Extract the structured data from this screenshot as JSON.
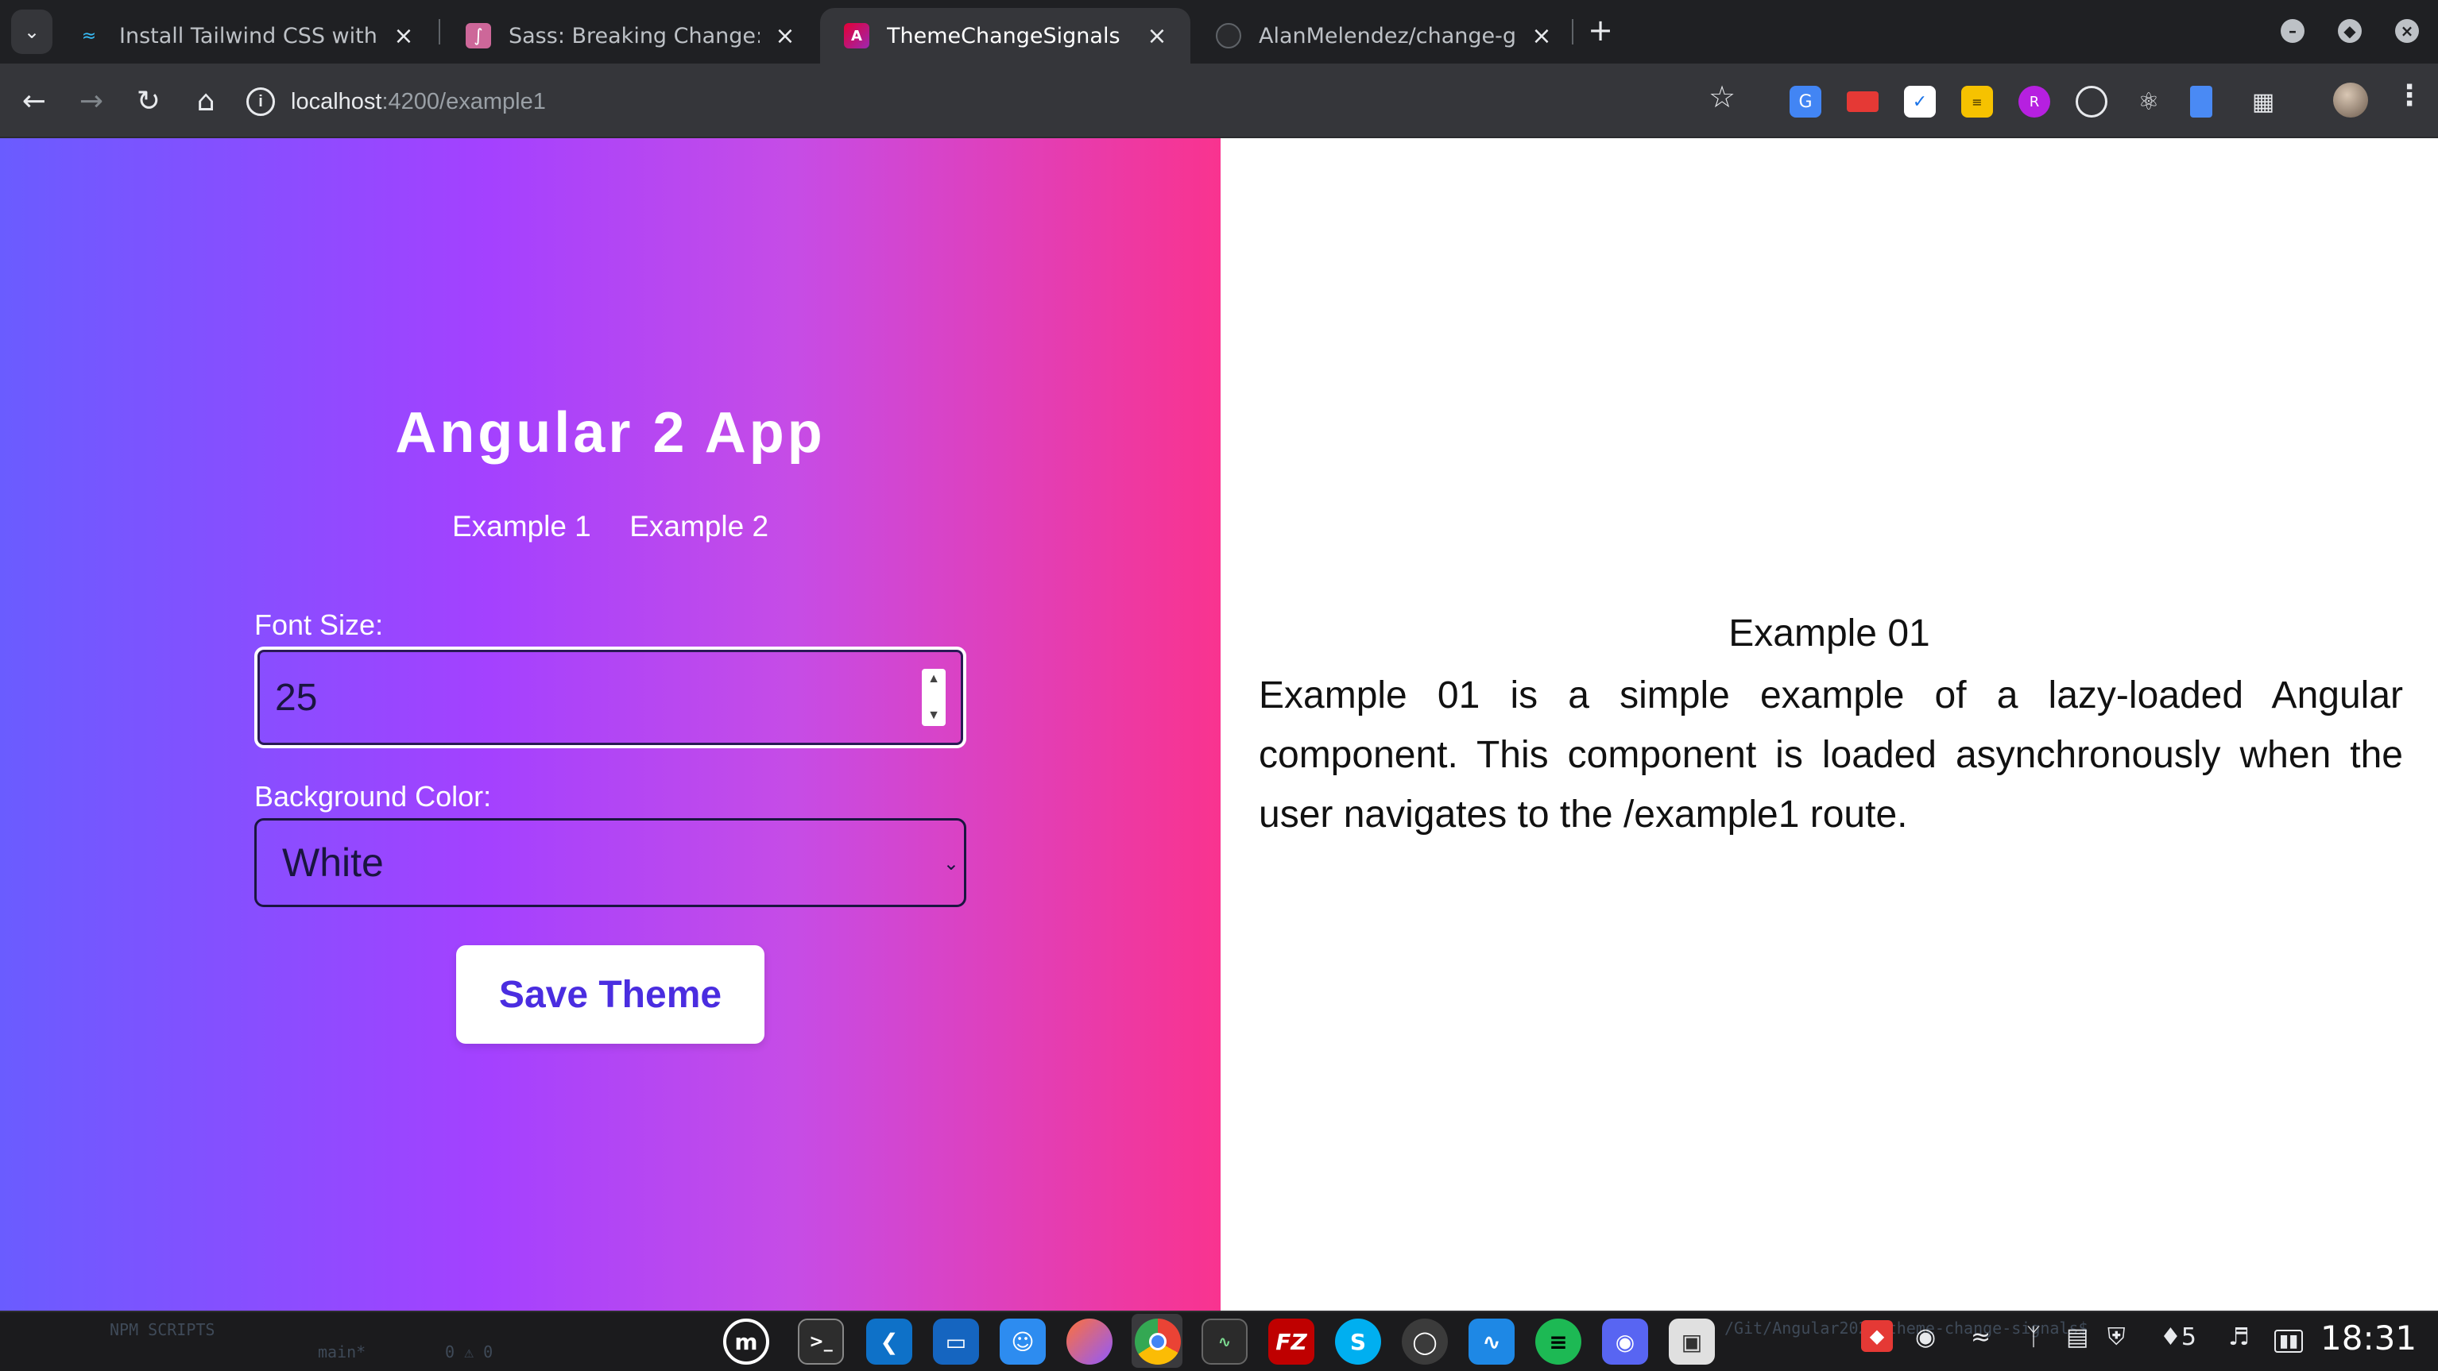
{
  "browser": {
    "tabs": [
      {
        "title": "Install Tailwind CSS with Ang",
        "favicon": "tailwind-icon",
        "active": false
      },
      {
        "title": "Sass: Breaking Change: `@im",
        "favicon": "sass-icon",
        "active": false
      },
      {
        "title": "ThemeChangeSignals",
        "favicon": "angular-icon",
        "active": true
      },
      {
        "title": "AlanMelendez/change-globa",
        "favicon": "github-icon",
        "active": false
      }
    ],
    "new_tab": "+",
    "address": {
      "host": "localhost",
      "rest": ":4200/example1"
    },
    "extensions": [
      "translate-icon",
      "cast-icon",
      "mailtrack-icon",
      "wappalyzer-icon",
      "refined-icon",
      "target-icon",
      "react-devtools-icon",
      "page-icon",
      "puzzle-icon"
    ]
  },
  "app": {
    "title": "Angular 2 App",
    "nav": [
      {
        "label": "Example 1"
      },
      {
        "label": "Example 2"
      }
    ],
    "font_size": {
      "label": "Font Size:",
      "value": "25"
    },
    "background_color": {
      "label": "Background Color:",
      "selected": "White"
    },
    "save_button": "Save Theme"
  },
  "content": {
    "heading": "Example 01",
    "body": "Example 01 is a simple example of a lazy-loaded Angular component. This component is loaded asynchronously when the user navigates to the /example1 route."
  },
  "taskbar": {
    "ghost_left": "NPM SCRIPTS",
    "ghost_branch": "main*",
    "ghost_counts": "0 ⚠ 0",
    "ghost_path": "/Git/Angular2025/theme-change-signals$",
    "apps": [
      "mint-menu-icon",
      "terminal-icon",
      "vscode-icon",
      "azure-data-studio-icon",
      "finder-icon",
      "firefox-icon",
      "chrome-icon",
      "system-monitor-icon",
      "filezilla-icon",
      "skype-icon",
      "remmina-icon",
      "activity-icon",
      "spotify-icon",
      "discord-icon",
      "screenshot-icon"
    ],
    "clock": "18:31",
    "notification_count": "5"
  }
}
